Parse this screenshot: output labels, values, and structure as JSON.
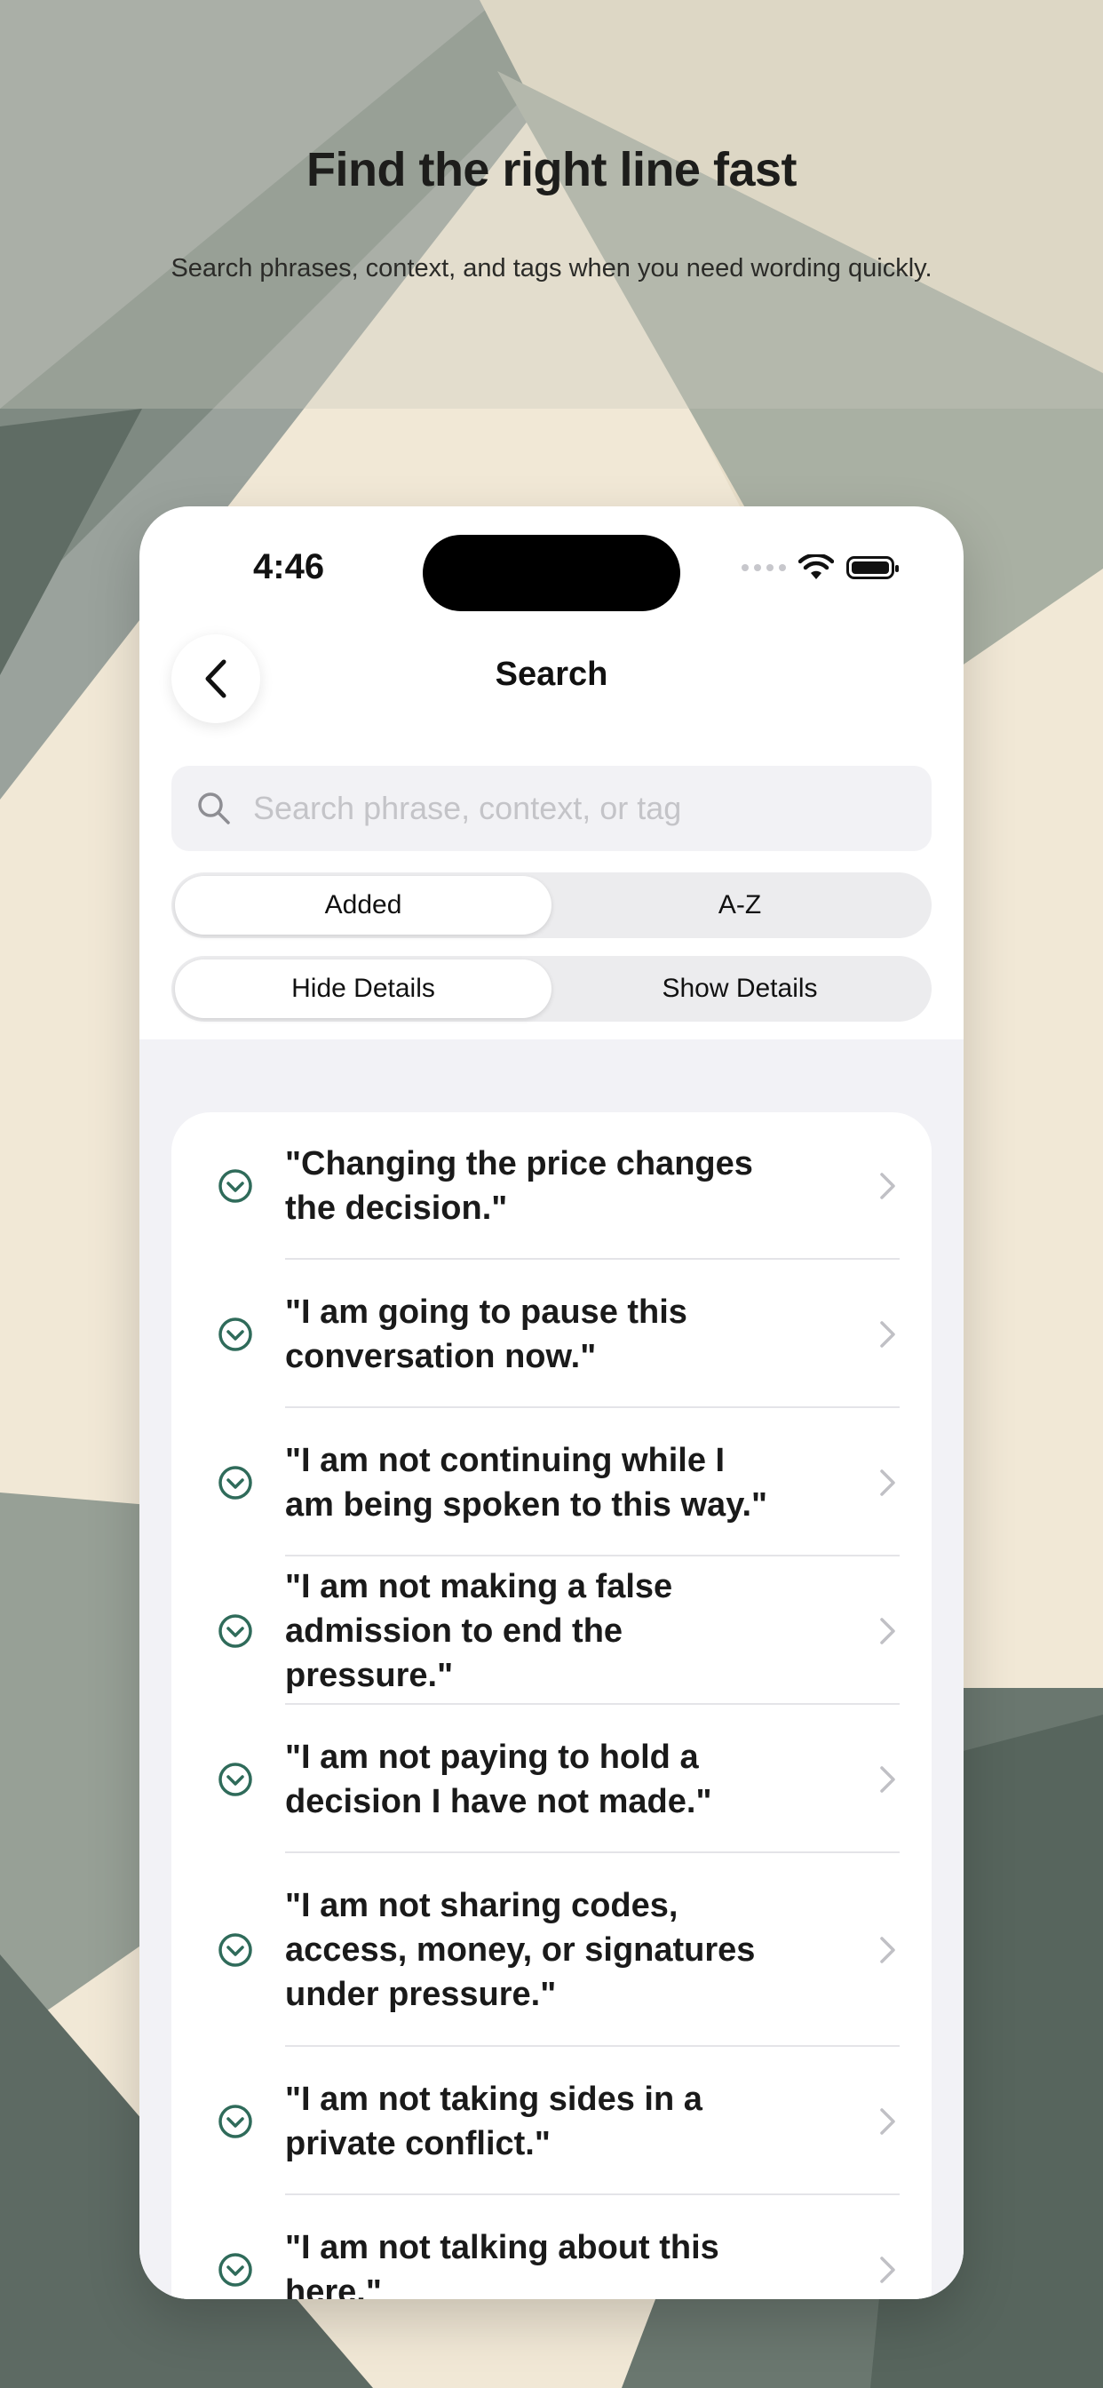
{
  "promo": {
    "headline": "Find the right line fast",
    "subheadline": "Search phrases, context, and tags when you need wording quickly."
  },
  "status_bar": {
    "time": "4:46"
  },
  "nav": {
    "title": "Search",
    "back_icon": "chevron-left-icon"
  },
  "search": {
    "placeholder": "Search phrase, context, or tag",
    "value": ""
  },
  "sort_control": {
    "options": [
      "Added",
      "A-Z"
    ],
    "selected": "Added"
  },
  "details_control": {
    "options": [
      "Hide Details",
      "Show Details"
    ],
    "selected": "Hide Details"
  },
  "colors": {
    "accent": "#2f6b5a",
    "card": "#ffffff",
    "list_bg": "#f2f2f6"
  },
  "phrases": [
    {
      "text": "\"Changing the price changes the decision.\""
    },
    {
      "text": "\"I am going to pause this conversation now.\""
    },
    {
      "text": "\"I am not continuing while I am being spoken to this way.\""
    },
    {
      "text": "\"I am not making a false admission to end the pressure.\""
    },
    {
      "text": "\"I am not paying to hold a decision I have not made.\""
    },
    {
      "text": "\"I am not sharing codes, access, money, or signatures under pressure.\""
    },
    {
      "text": "\"I am not taking sides in a private conflict.\""
    },
    {
      "text": "\"I am not talking about this here.\""
    }
  ]
}
